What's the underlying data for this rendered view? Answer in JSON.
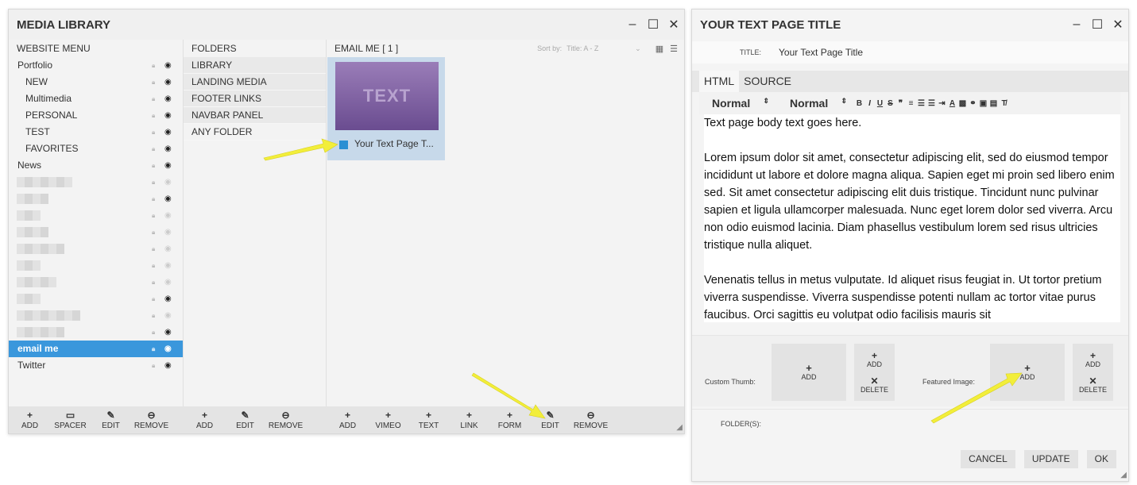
{
  "media_library": {
    "title": "MEDIA LIBRARY",
    "menu_header": "WEBSITE MENU",
    "menu_items": [
      {
        "label": "Portfolio",
        "level": 0
      },
      {
        "label": "NEW",
        "level": 1
      },
      {
        "label": "Multimedia",
        "level": 1
      },
      {
        "label": "PERSONAL",
        "level": 1
      },
      {
        "label": "TEST",
        "level": 1
      },
      {
        "label": "FAVORITES",
        "level": 1
      },
      {
        "label": "News",
        "level": 0
      }
    ],
    "selected_item": "email me",
    "last_item": "Twitter",
    "folders_header": "FOLDERS",
    "folders": [
      "LIBRARY",
      "LANDING MEDIA",
      "FOOTER LINKS",
      "NAVBAR PANEL",
      "ANY FOLDER"
    ],
    "items_header": "EMAIL ME  [ 1 ]",
    "sort_label": "Sort by:",
    "sort_value": "Title: A - Z",
    "tile": {
      "thumb_text": "TEXT",
      "label": "Your Text Page T..."
    },
    "menu_toolbar": [
      "ADD",
      "SPACER",
      "EDIT",
      "REMOVE"
    ],
    "folder_toolbar": [
      "ADD",
      "EDIT",
      "REMOVE"
    ],
    "items_toolbar": [
      "ADD",
      "VIMEO",
      "TEXT",
      "LINK",
      "FORM",
      "EDIT",
      "REMOVE"
    ]
  },
  "editor": {
    "title": "YOUR TEXT PAGE TITLE",
    "title_label": "TITLE:",
    "title_value": "Your Text Page Title",
    "tabs": [
      "HTML",
      "SOURCE"
    ],
    "format_1": "Normal",
    "format_2": "Normal",
    "body": [
      "Text page body text goes here.",
      "Lorem ipsum dolor sit amet, consectetur adipiscing elit, sed do eiusmod tempor incididunt ut labore et dolore magna aliqua. Sapien eget mi proin sed libero enim sed. Sit amet consectetur adipiscing elit duis tristique. Tincidunt nunc pulvinar sapien et ligula ullamcorper malesuada. Nunc eget lorem dolor sed viverra. Arcu non odio euismod lacinia. Diam phasellus vestibulum lorem sed risus ultricies tristique nulla aliquet.",
      "Venenatis tellus in metus vulputate. Id aliquet risus feugiat in. Ut tortor pretium viverra suspendisse. Viverra suspendisse potenti nullam ac tortor vitae purus faucibus. Orci sagittis eu volutpat odio facilisis mauris sit"
    ],
    "custom_thumb_label": "Custom Thumb:",
    "featured_image_label": "Featured Image:",
    "add_label": "ADD",
    "delete_label": "DELETE",
    "folders_label": "FOLDER(S):",
    "cancel": "CANCEL",
    "update": "UPDATE",
    "ok": "OK"
  },
  "colors": {
    "selected": "#3a97dc",
    "arrow": "#f2ee3a"
  }
}
